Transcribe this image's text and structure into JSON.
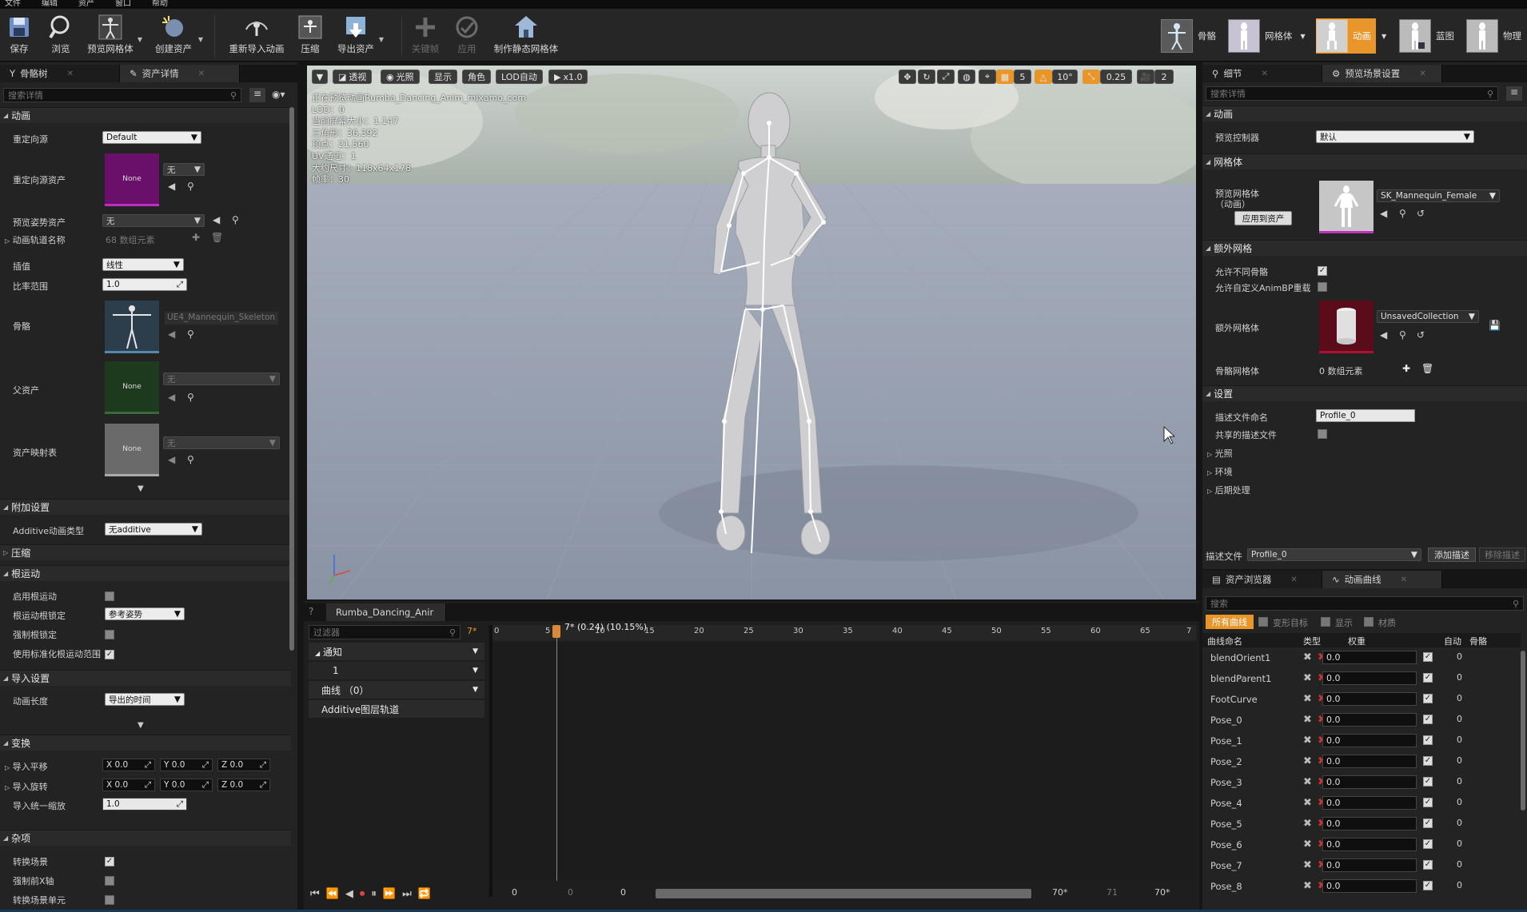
{
  "menu": [
    "文件",
    "编辑",
    "资产",
    "窗口",
    "帮助"
  ],
  "toolbar": {
    "save": "保存",
    "browse": "浏览",
    "preview_mesh": "预览网格体",
    "create_asset": "创建资产",
    "reimport": "重新导入动画",
    "compress": "压缩",
    "export": "导出资产",
    "keyframe": "关键帧",
    "apply": "应用",
    "make_static": "制作静态网格体"
  },
  "modes": {
    "skeleton": "骨骼",
    "mesh": "网格体",
    "animation": "动画",
    "blueprint": "蓝图",
    "physics": "物理"
  },
  "left": {
    "tab_skeleton_tree": "骨骼树",
    "tab_asset_details": "资产详情",
    "search_placeholder": "搜索详情",
    "cat_animation": "动画",
    "retarget_source_label": "重定向源",
    "retarget_source_value": "Default",
    "retarget_asset_label": "重定向源资产",
    "retarget_asset_value": "无",
    "thumb_none": "None",
    "preview_pose_label": "预览姿势资产",
    "preview_pose_value": "无",
    "track_names_label": "动画轨道名称",
    "track_names_value": "68 数组元素",
    "interp_label": "插值",
    "interp_value": "线性",
    "rate_label": "比率范围",
    "rate_value": "1.0",
    "skeleton_label": "骨骼",
    "skeleton_value": "UE4_Mannequin_Skeleton",
    "parent_label": "父资产",
    "parent_value": "无",
    "asset_map_label": "资产映射表",
    "asset_map_value": "无",
    "cat_additive": "附加设置",
    "additive_type_label": "Additive动画类型",
    "additive_type_value": "无additive",
    "cat_compress": "压缩",
    "cat_root_motion": "根运动",
    "enable_root_label": "启用根运动",
    "root_lock_label": "根运动根锁定",
    "root_lock_value": "参考姿势",
    "force_root_lock_label": "强制根锁定",
    "normalize_root_label": "使用标准化根运动范围",
    "cat_import": "导入设置",
    "anim_length_label": "动画长度",
    "anim_length_value": "导出的时间",
    "cat_transform": "变换",
    "import_translation_label": "导入平移",
    "import_rotation_label": "导入旋转",
    "import_scale_label": "导入统一缩放",
    "import_scale_value": "1.0",
    "x_val": "X 0.0",
    "y_val": "Y 0.0",
    "z_val": "Z 0.0",
    "cat_misc": "杂项",
    "convert_scene_label": "转换场景",
    "force_front_x_label": "强制前X轴",
    "convert_scene_unit_label": "转换场景单元"
  },
  "viewport": {
    "btn_perspective": "透视",
    "btn_lit": "光照",
    "btn_show": "显示",
    "btn_character": "角色",
    "btn_lod": "LOD自动",
    "btn_speed": "x1.0",
    "grid_val": "5",
    "angle_val": "10°",
    "scale_val": "0.25",
    "cam_val": "2",
    "info": [
      "正在预览动画Rumba_Dancing_Anim_mixamo_com",
      "LOD：0",
      "当前屏幕大小：1.147",
      "三角形：36,392",
      "顶点：21,560",
      "UV通道：1",
      "大约尺寸：118x64x178",
      "帧率：30"
    ]
  },
  "timeline": {
    "tab": "Rumba_Dancing_Anir",
    "filter_placeholder": "过滤器",
    "frame_marker": "7*",
    "playhead_label": "7* (0.24) (10.15%)",
    "notify": "通知",
    "track_one": "1",
    "curves": "曲线 （0）",
    "additive_layer": "Additive图层轨道",
    "ruler": [
      "0",
      "5",
      "10",
      "15",
      "20",
      "25",
      "30",
      "35",
      "40",
      "45",
      "50",
      "55",
      "60",
      "65",
      "7"
    ],
    "bottom_start": "0",
    "bottom_a": "0",
    "bottom_b": "0",
    "bottom_end_a": "70*",
    "bottom_end_b": "71",
    "bottom_end_c": "70*"
  },
  "right": {
    "tab_details": "细节",
    "tab_preview_scene": "预览场景设置",
    "search_placeholder": "搜索详情",
    "cat_animation": "动画",
    "preview_controller_label": "预览控制器",
    "preview_controller_value": "默认",
    "cat_mesh": "网格体",
    "preview_mesh_label": "预览网格体",
    "preview_mesh_sub": "（动画）",
    "apply_to_asset": "应用到资产",
    "preview_mesh_value": "SK_Mannequin_Female",
    "cat_extra_mesh": "额外网格",
    "allow_diff_skel_label": "允许不同骨骼",
    "allow_custom_bp_label": "允许自定义AnimBP重载",
    "extra_mesh_label": "额外网格体",
    "extra_mesh_value": "UnsavedCollection",
    "skel_meshes_label": "骨骼网格体",
    "skel_meshes_value": "0 数组元素",
    "cat_settings": "设置",
    "profile_name_label": "描述文件命名",
    "profile_name_value": "Profile_0",
    "shared_profile_label": "共享的描述文件",
    "cat_lighting": "光照",
    "cat_environment": "环境",
    "cat_postprocess": "后期处理",
    "profile_label": "描述文件",
    "profile_value": "Profile_0",
    "add_profile": "添加描述",
    "remove_profile": "移除描述"
  },
  "curves_panel": {
    "tab_asset_browser": "资产浏览器",
    "tab_anim_curves": "动画曲线",
    "search_placeholder": "搜索",
    "filter_all": "所有曲线",
    "filter_morph": "变形目标",
    "filter_show": "显示",
    "filter_material": "材质",
    "col_name": "曲线命名",
    "col_type": "类型",
    "col_weight": "权重",
    "col_auto": "自动",
    "col_bone": "骨骼",
    "rows": [
      {
        "name": "blendOrient1",
        "weight": "0.0",
        "bone": "0"
      },
      {
        "name": "blendParent1",
        "weight": "0.0",
        "bone": "0"
      },
      {
        "name": "FootCurve",
        "weight": "0.0",
        "bone": "0"
      },
      {
        "name": "Pose_0",
        "weight": "0.0",
        "bone": "0"
      },
      {
        "name": "Pose_1",
        "weight": "0.0",
        "bone": "0"
      },
      {
        "name": "Pose_2",
        "weight": "0.0",
        "bone": "0"
      },
      {
        "name": "Pose_3",
        "weight": "0.0",
        "bone": "0"
      },
      {
        "name": "Pose_4",
        "weight": "0.0",
        "bone": "0"
      },
      {
        "name": "Pose_5",
        "weight": "0.0",
        "bone": "0"
      },
      {
        "name": "Pose_6",
        "weight": "0.0",
        "bone": "0"
      },
      {
        "name": "Pose_7",
        "weight": "0.0",
        "bone": "0"
      },
      {
        "name": "Pose_8",
        "weight": "0.0",
        "bone": "0"
      }
    ]
  },
  "colors": {
    "accent": "#e8952a",
    "panel_bg": "#232323",
    "viewport_floor": "#8f98a8"
  }
}
